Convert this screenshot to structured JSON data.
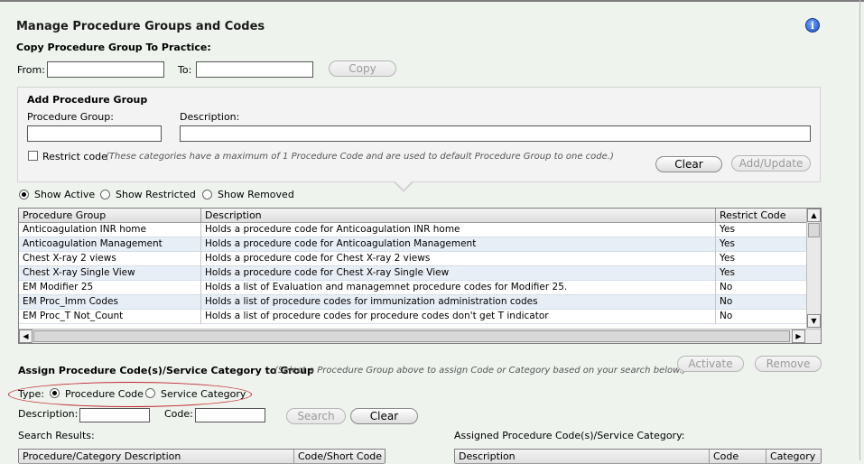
{
  "page": {
    "title": "Manage Procedure Groups and Codes",
    "info_icon": "info-icon"
  },
  "copy_section": {
    "title": "Copy Procedure Group To Practice:",
    "from_label": "From:",
    "from_value": "",
    "to_label": "To:",
    "to_value": "",
    "copy_button": "Copy"
  },
  "add_group": {
    "title": "Add Procedure Group",
    "group_label": "Procedure Group:",
    "group_value": "",
    "description_label": "Description:",
    "description_value": "",
    "restrict_label": "Restrict code",
    "restrict_checked": false,
    "restrict_note": "(These categories have a maximum of 1 Procedure Code and are used to default Procedure Group to one code.)",
    "clear_button": "Clear",
    "add_update_button": "Add/Update"
  },
  "filters": {
    "options": [
      "Show Active",
      "Show Restricted",
      "Show Removed"
    ],
    "selected": "Show Active"
  },
  "groups_table": {
    "columns": [
      "Procedure Group",
      "Description",
      "Restrict Code"
    ],
    "rows": [
      [
        "Anticoagulation INR home",
        "Holds a procedure code for Anticoagulation INR home",
        "Yes"
      ],
      [
        "Anticoagulation Management",
        "Holds a procedure code for Anticoagulation Management",
        "Yes"
      ],
      [
        "Chest X-ray 2 views",
        "Holds a procedure code for Chest X-ray 2 views",
        "Yes"
      ],
      [
        "Chest X-ray Single View",
        "Holds a procedure code for Chest X-ray Single View",
        "Yes"
      ],
      [
        "EM Modifier 25",
        "Holds a list of Evaluation and managemnet procedure codes for Modifier 25.",
        "No"
      ],
      [
        "EM Proc_Imm Codes",
        "Holds a list of procedure codes for immunization administration codes",
        "No"
      ],
      [
        "EM Proc_T Not_Count",
        "Holds a list of procedure codes for procedure codes don't get T indicator",
        "No"
      ]
    ]
  },
  "assign_section": {
    "title": "Assign Procedure Code(s)/Service Category to Group",
    "note": "(Select a Procedure Group above to assign Code or Category based on your search below.)",
    "activate_button": "Activate",
    "remove_button": "Remove",
    "type_label": "Type:",
    "type_options": [
      "Procedure Code",
      "Service Category"
    ],
    "type_selected": "Procedure Code",
    "description_label": "Description:",
    "description_value": "",
    "code_label": "Code:",
    "code_value": "",
    "search_button": "Search",
    "clear_button": "Clear"
  },
  "search_results": {
    "title": "Search Results:",
    "columns": [
      "Procedure/Category Description",
      "Code/Short Code"
    ]
  },
  "assigned": {
    "title": "Assigned Procedure Code(s)/Service Category:",
    "columns": [
      "Description",
      "Code",
      "Category"
    ]
  },
  "colors": {
    "background": "#eef3ee",
    "row_alt": "#e8eef6",
    "highlight": "#c0282b",
    "info_blue": "#1f4fc6"
  }
}
